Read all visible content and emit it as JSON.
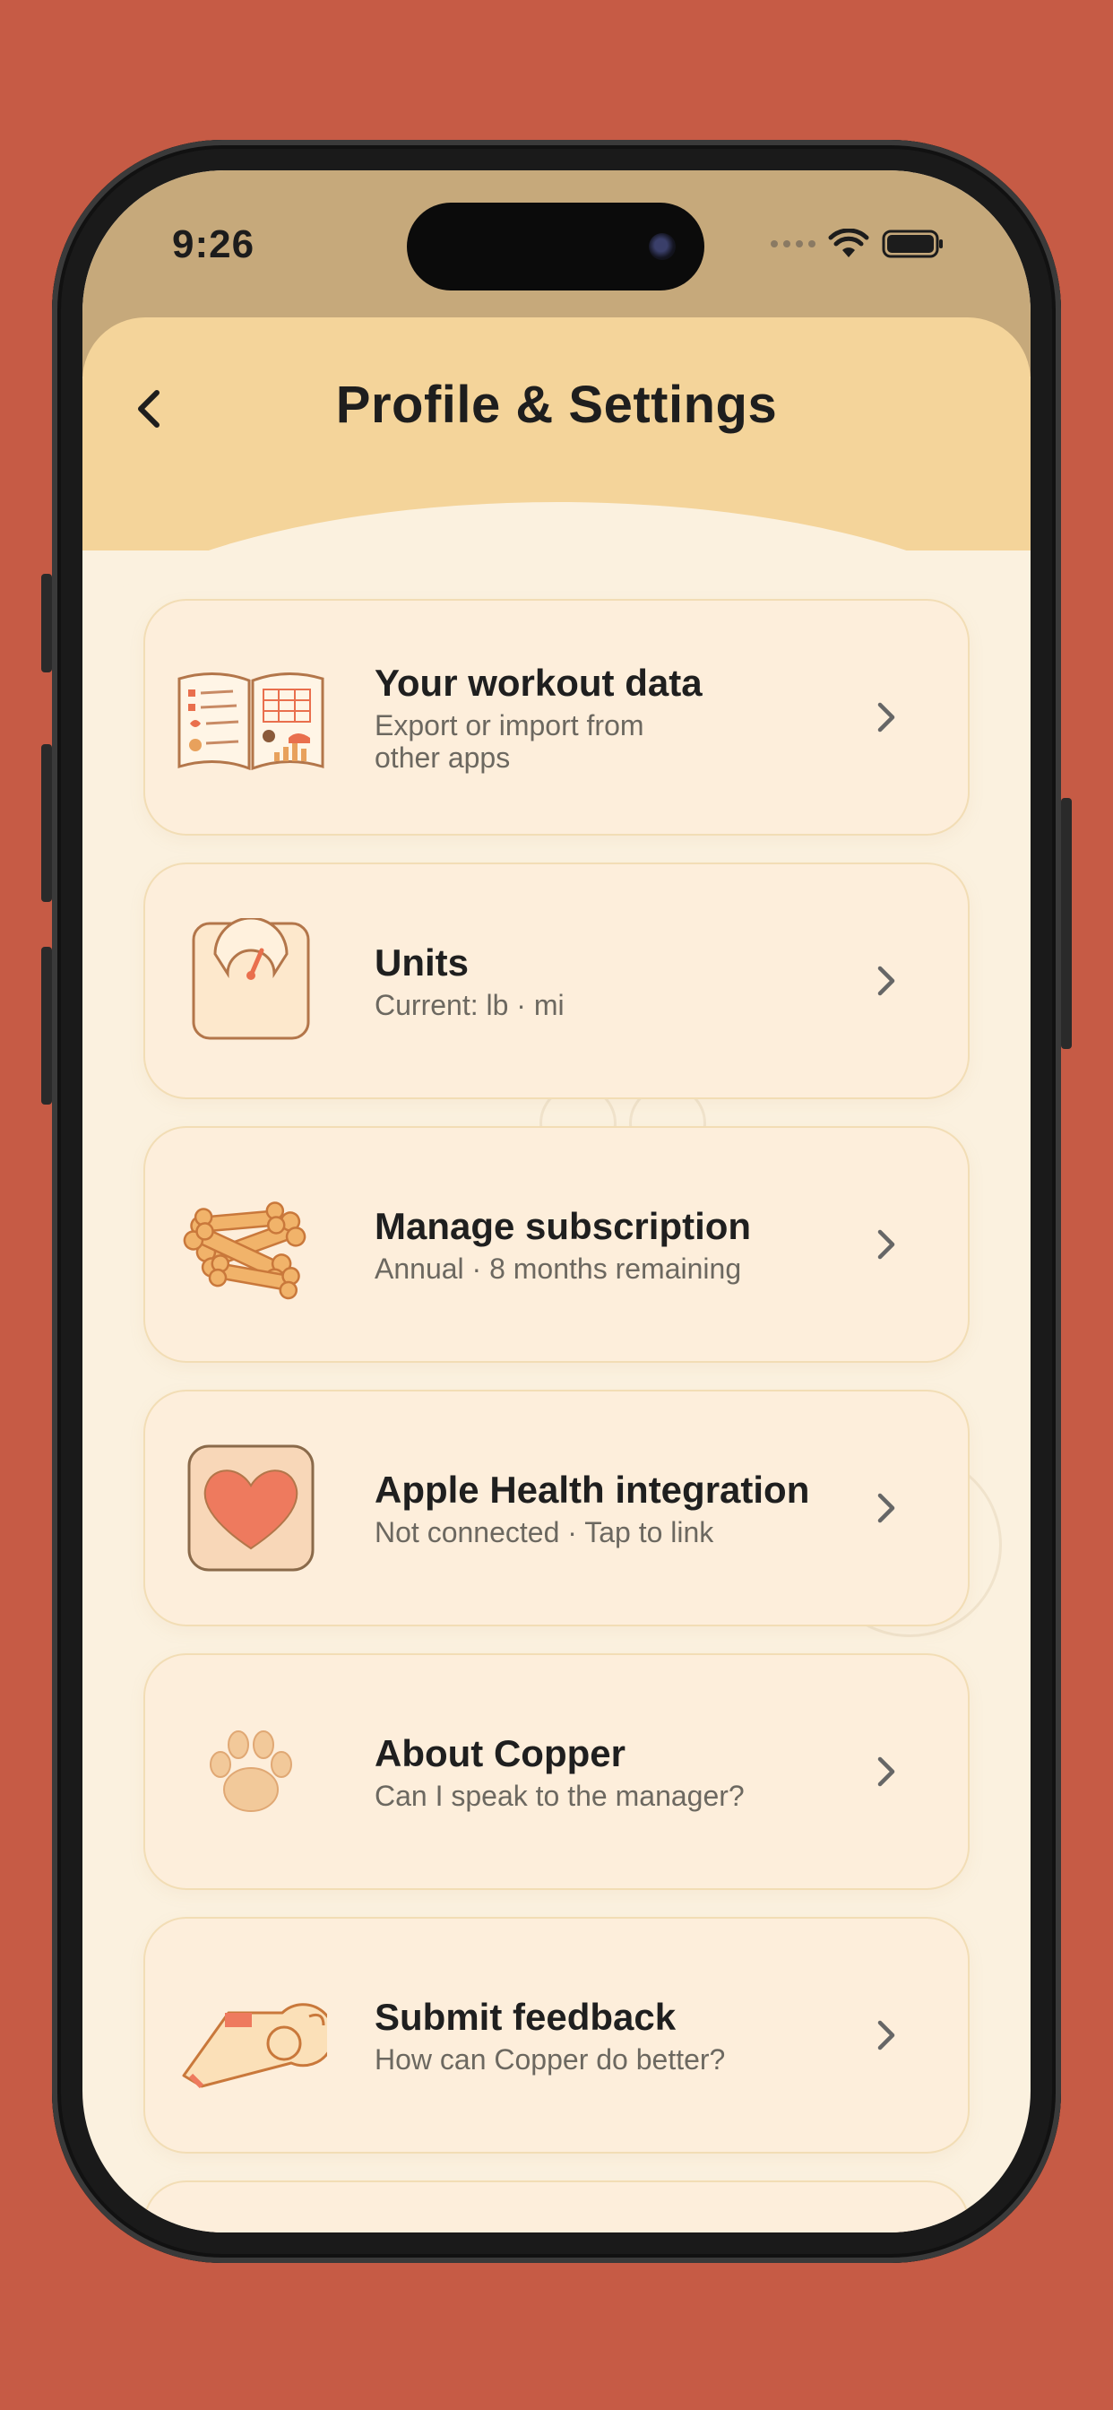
{
  "status_bar": {
    "time": "9:26"
  },
  "header": {
    "title": "Profile & Settings"
  },
  "items": [
    {
      "title": "Your workout data",
      "subtitle": "Export or import from other apps",
      "icon": "workout-journal-icon"
    },
    {
      "title": "Units",
      "subtitle": "Current: lb · mi",
      "icon": "scale-icon"
    },
    {
      "title": "Manage subscription",
      "subtitle": "Annual · 8 months remaining",
      "icon": "dog-bones-icon"
    },
    {
      "title": "Apple Health integration",
      "subtitle": "Not connected · Tap to link",
      "icon": "heart-icon"
    },
    {
      "title": "About Copper",
      "subtitle": "Can I speak to the manager?",
      "icon": "paw-icon"
    },
    {
      "title": "Submit feedback",
      "subtitle": "How can Copper do better?",
      "icon": "whistle-icon"
    }
  ],
  "colors": {
    "background": "#c65b45",
    "header": "#f4d49a",
    "status_bar": "#c6a97b",
    "screen": "#fbf1df",
    "card": "#fdeedb"
  }
}
